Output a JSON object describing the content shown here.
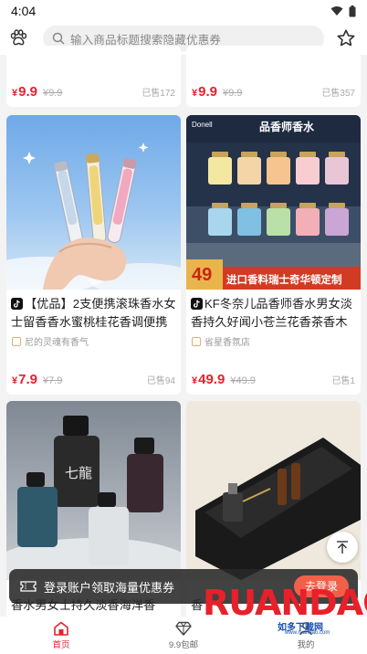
{
  "status_bar": {
    "time": "4:04"
  },
  "search": {
    "placeholder": "输入商品标题搜索隐藏优惠券"
  },
  "top_row": [
    {
      "price": "9.9",
      "orig": "9.9",
      "sold": "已售172"
    },
    {
      "price": "9.9",
      "orig": "9.9",
      "sold": "已售357"
    }
  ],
  "products": [
    {
      "title": "【优品】2支便携滚珠香水女士留香香水蜜桃桂花香调便携式...",
      "shop": "尼的灵魂有香气",
      "price": "7.9",
      "orig": "7.9",
      "sold": "已售94"
    },
    {
      "title": "KF冬奈儿品香师香水男女淡香持久好闻小苍兰花香茶香木质香",
      "shop": "省星香氛店",
      "price": "49.9",
      "orig": "49.9",
      "sold": "已售1",
      "img_brand": "Donell",
      "img_headline": "品香师香水",
      "img_badge_price": "49",
      "img_badge_note": "进口香料瑞士奇华顿定制"
    },
    {
      "title": "香水男女士持久淡香海洋香男...",
      "img_label": "七龍"
    },
    {
      "title": "香"
    }
  ],
  "banner": {
    "text": "登录账户领取海量优惠券",
    "button": "去登录"
  },
  "tabs": [
    {
      "label": "首页",
      "icon": "home-icon",
      "active": true
    },
    {
      "label": "9.9包邮",
      "icon": "diamond-icon",
      "active": false
    },
    {
      "label": "我的",
      "icon": "user-icon",
      "active": false
    }
  ],
  "watermark": {
    "logo": "RUANDAO",
    "sub": "如多下载网",
    "url": "www.ruandao.com"
  },
  "colors": {
    "price": "#e2232f",
    "accent": "#f2604a"
  }
}
